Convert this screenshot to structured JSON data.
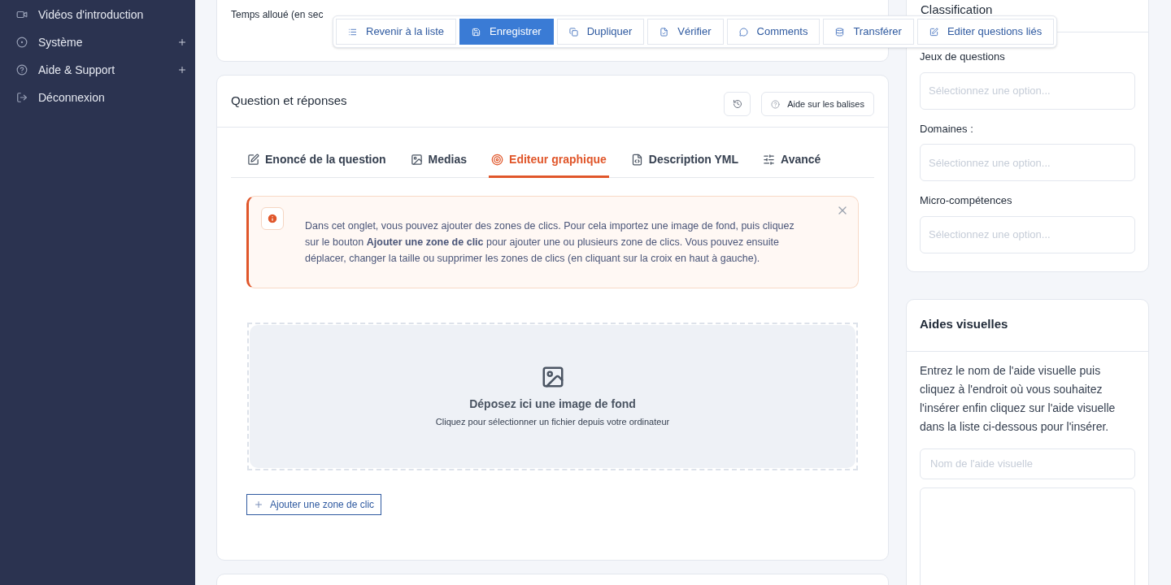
{
  "sidebar": {
    "items": [
      {
        "label": "Vidéos d'introduction",
        "kind": "video",
        "expandable": false
      },
      {
        "label": "Système",
        "kind": "settings",
        "expandable": true
      },
      {
        "label": "Aide & Support",
        "kind": "help",
        "expandable": true
      },
      {
        "label": "Déconnexion",
        "kind": "logout",
        "expandable": false
      }
    ]
  },
  "toolbar": [
    {
      "label": "Revenir à la liste",
      "kind": "list",
      "selected": false
    },
    {
      "label": "Enregistrer",
      "kind": "save",
      "selected": true
    },
    {
      "label": "Dupliquer",
      "kind": "copy",
      "selected": false
    },
    {
      "label": "Vérifier",
      "kind": "check",
      "selected": false
    },
    {
      "label": "Comments",
      "kind": "comment",
      "selected": false
    },
    {
      "label": "Transférer",
      "kind": "database",
      "selected": false
    },
    {
      "label": "Editer questions liés",
      "kind": "edit",
      "selected": false
    }
  ],
  "settings_card": {
    "field_label": "Temps alloué (en sec"
  },
  "question_card": {
    "title": "Question et réponses",
    "help_button": "Aide sur les balises",
    "tabs": [
      {
        "label": "Enoncé de la question",
        "kind": "edit",
        "selected": false
      },
      {
        "label": "Medias",
        "kind": "image",
        "selected": false
      },
      {
        "label": "Editeur graphique",
        "kind": "target",
        "selected": true
      },
      {
        "label": "Description YML",
        "kind": "file",
        "selected": false
      },
      {
        "label": "Avancé",
        "kind": "sliders",
        "selected": false
      }
    ],
    "alert": "Dans cet onglet, vous pouvez ajouter des zones de clics. Pour cela importez une image de fond, puis cliquez sur le bouton **Ajouter une zone de clic** pour ajouter une ou plusieurs zone de clics. Vous pouvez ensuite déplacer, changer la taille ou supprimer les zones de clics (en cliquant sur la croix en haut à gauche).",
    "dropzone": {
      "title": "Déposez ici une image de fond",
      "subtitle": "Cliquez pour sélectionner un fichier depuis votre ordinateur"
    },
    "add_button": "Ajouter une zone de clic"
  },
  "classification": {
    "title": "Classification",
    "fields": [
      {
        "label": "Jeux de questions",
        "placeholder": "Sélectionnez une option..."
      },
      {
        "label": "Domaines :",
        "placeholder": "Sélectionnez une option..."
      },
      {
        "label": "Micro-compétences",
        "placeholder": "Sélectionnez une option..."
      }
    ]
  },
  "visual_aids": {
    "title": "Aides visuelles",
    "text": "Entrez le nom de l'aide visuelle puis cliquez à l'endroit où vous souhaitez l'insérer enfin cliquez sur l'aide visuelle dans la liste ci-dessous pour l'insérer.",
    "placeholder": "Nom de l'aide visuelle"
  }
}
